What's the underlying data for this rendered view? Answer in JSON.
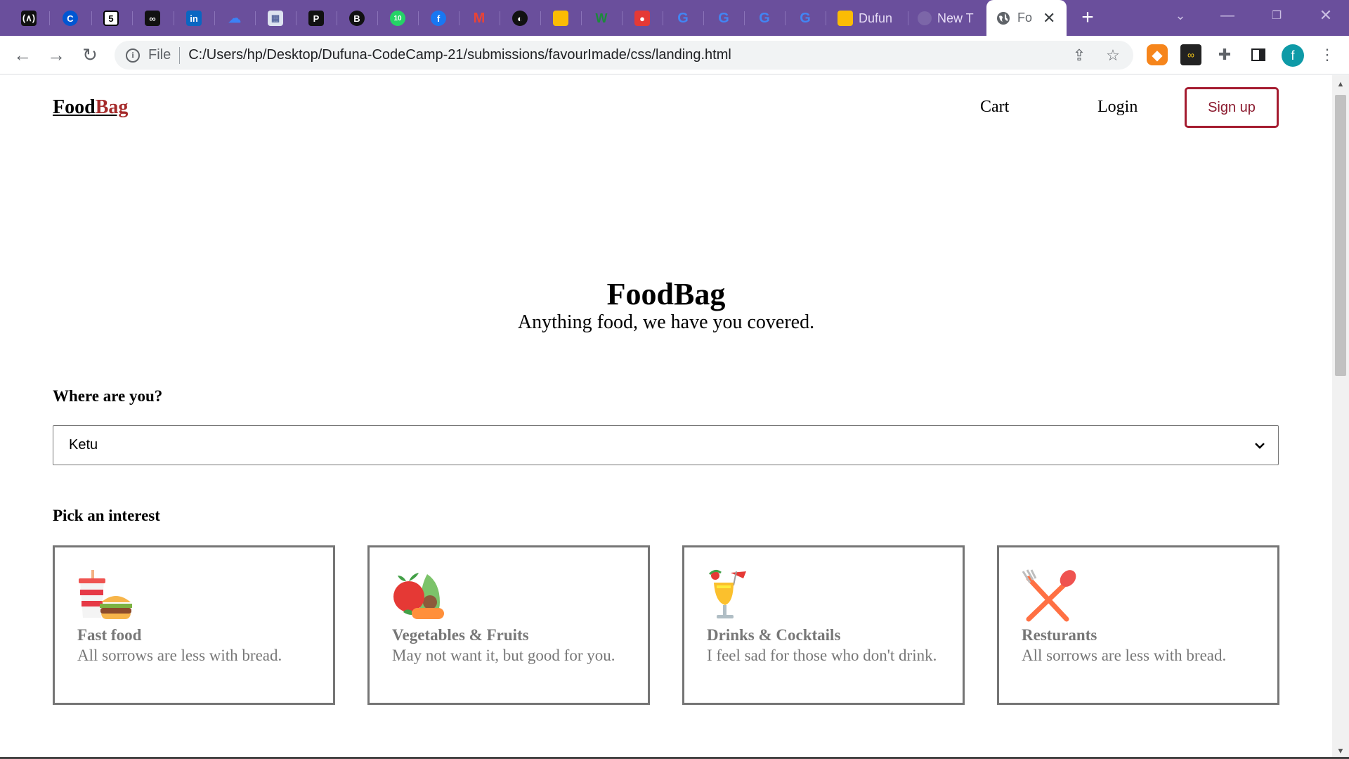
{
  "browser": {
    "tabs": [
      {
        "icon": "code-academy-icon"
      },
      {
        "icon": "coursera-c-icon"
      },
      {
        "icon": "html5-shield-icon"
      },
      {
        "icon": "chain-link-icon"
      },
      {
        "icon": "linkedin-icon"
      },
      {
        "icon": "cloud-icon"
      },
      {
        "icon": "gallery-icon"
      },
      {
        "icon": "pocket-p-icon"
      },
      {
        "icon": "b-icon"
      },
      {
        "icon": "whatsapp-icon"
      },
      {
        "icon": "facebook-icon"
      },
      {
        "icon": "gmail-icon"
      },
      {
        "icon": "github-icon"
      },
      {
        "icon": "google-slides-icon"
      },
      {
        "icon": "w-icon"
      },
      {
        "icon": "record-icon"
      },
      {
        "icon": "google-icon"
      },
      {
        "icon": "google-icon"
      },
      {
        "icon": "google-icon"
      },
      {
        "icon": "google-icon"
      }
    ],
    "text_tabs": [
      {
        "label": "Dufun",
        "icon": "google-slides-icon"
      },
      {
        "label": "New T",
        "icon": "globe-icon"
      }
    ],
    "active_tab": {
      "label": "Fo",
      "icon": "globe-icon"
    },
    "address": {
      "scheme_label": "File",
      "url": "C:/Users/hp/Desktop/Dufuna-CodeCamp-21/submissions/favourImade/css/landing.html"
    },
    "profile_initial": "f"
  },
  "page": {
    "brand": {
      "part1": "Food",
      "part2": "Bag"
    },
    "nav": {
      "cart": "Cart",
      "login": "Login",
      "signup": "Sign up"
    },
    "hero": {
      "title": "FoodBag",
      "subtitle": "Anything food, we have you covered."
    },
    "location": {
      "label": "Where are you?",
      "selected": "Ketu"
    },
    "interests": {
      "label": "Pick an interest",
      "cards": [
        {
          "title": "Fast food",
          "desc": "All sorrows are less with bread.",
          "icon": "fast-food-icon"
        },
        {
          "title": "Vegetables & Fruits",
          "desc": "May not want it, but good for you.",
          "icon": "fruits-vegetables-icon"
        },
        {
          "title": "Drinks & Cocktails",
          "desc": "I feel sad for those who don't drink.",
          "icon": "cocktail-icon"
        },
        {
          "title": "Resturants",
          "desc": "All sorrows are less with bread.",
          "icon": "fork-spoon-icon"
        }
      ]
    }
  },
  "colors": {
    "tabstrip": "#6a4f9c",
    "brand_accent": "#a52a2a",
    "signup_border": "#a51c30",
    "card_text": "#777777"
  }
}
